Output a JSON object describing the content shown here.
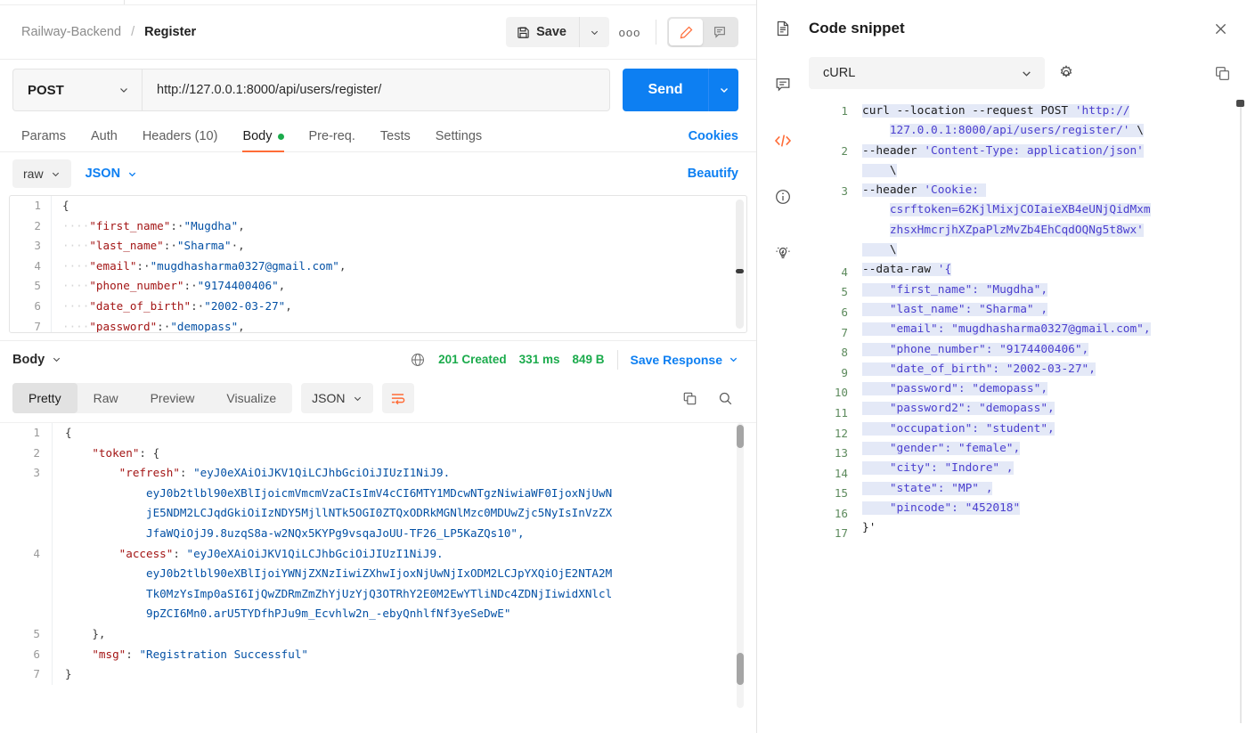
{
  "breadcrumb": {
    "collection": "Railway-Backend",
    "separator": "/",
    "current": "Register"
  },
  "toolbar": {
    "save_label": "Save",
    "save_icon": "floppy-disk-icon",
    "caret_icon": "chevron-down-icon",
    "more_icon": "ellipsis-icon",
    "more_label": "ooo",
    "edit_icon": "pencil-icon",
    "comment_icon": "comment-icon"
  },
  "request": {
    "method": "POST",
    "url": "http://127.0.0.1:8000/api/users/register/",
    "send_label": "Send",
    "tabs": [
      {
        "label": "Params",
        "active": false,
        "dot": false
      },
      {
        "label": "Auth",
        "active": false,
        "dot": false
      },
      {
        "label": "Headers (10)",
        "active": false,
        "dot": false
      },
      {
        "label": "Body",
        "active": true,
        "dot": true
      },
      {
        "label": "Pre-req.",
        "active": false,
        "dot": false
      },
      {
        "label": "Tests",
        "active": false,
        "dot": false
      },
      {
        "label": "Settings",
        "active": false,
        "dot": false
      }
    ],
    "cookies_label": "Cookies",
    "body_mode": "raw",
    "body_format": "JSON",
    "beautify_label": "Beautify",
    "body_lines": [
      {
        "n": "1",
        "segs": [
          {
            "t": "{",
            "c": "jpun"
          }
        ]
      },
      {
        "n": "2",
        "segs": [
          {
            "t": "····",
            "c": "jdot"
          },
          {
            "t": "\"first_name\"",
            "c": "jkey"
          },
          {
            "t": ":·",
            "c": "jpun"
          },
          {
            "t": "\"Mugdha\"",
            "c": "jstr"
          },
          {
            "t": ",",
            "c": "jpun"
          }
        ]
      },
      {
        "n": "3",
        "segs": [
          {
            "t": "····",
            "c": "jdot"
          },
          {
            "t": "\"last_name\"",
            "c": "jkey"
          },
          {
            "t": ":·",
            "c": "jpun"
          },
          {
            "t": "\"Sharma\"",
            "c": "jstr"
          },
          {
            "t": "·,",
            "c": "jpun"
          }
        ]
      },
      {
        "n": "4",
        "segs": [
          {
            "t": "····",
            "c": "jdot"
          },
          {
            "t": "\"email\"",
            "c": "jkey"
          },
          {
            "t": ":·",
            "c": "jpun"
          },
          {
            "t": "\"mugdhasharma0327@gmail.com\"",
            "c": "jstr"
          },
          {
            "t": ",",
            "c": "jpun"
          }
        ]
      },
      {
        "n": "5",
        "segs": [
          {
            "t": "····",
            "c": "jdot"
          },
          {
            "t": "\"phone_number\"",
            "c": "jkey"
          },
          {
            "t": ":·",
            "c": "jpun"
          },
          {
            "t": "\"9174400406\"",
            "c": "jstr"
          },
          {
            "t": ",",
            "c": "jpun"
          }
        ]
      },
      {
        "n": "6",
        "segs": [
          {
            "t": "····",
            "c": "jdot"
          },
          {
            "t": "\"date_of_birth\"",
            "c": "jkey"
          },
          {
            "t": ":·",
            "c": "jpun"
          },
          {
            "t": "\"2002-03-27\"",
            "c": "jstr"
          },
          {
            "t": ",",
            "c": "jpun"
          }
        ]
      },
      {
        "n": "7",
        "segs": [
          {
            "t": "····",
            "c": "jdot"
          },
          {
            "t": "\"password\"",
            "c": "jkey"
          },
          {
            "t": ":·",
            "c": "jpun"
          },
          {
            "t": "\"demopass\"",
            "c": "jstr"
          },
          {
            "t": ",",
            "c": "jpun"
          }
        ]
      }
    ]
  },
  "response": {
    "section_label": "Body",
    "globe_icon": "globe-icon",
    "status": "201 Created",
    "time": "331 ms",
    "size": "849 B",
    "save_response_label": "Save Response",
    "views": [
      {
        "label": "Pretty",
        "active": true
      },
      {
        "label": "Raw",
        "active": false
      },
      {
        "label": "Preview",
        "active": false
      },
      {
        "label": "Visualize",
        "active": false
      }
    ],
    "format": "JSON",
    "wrap_icon": "word-wrap-icon",
    "copy_icon": "copy-icon",
    "search_icon": "search-icon",
    "body_lines": [
      {
        "n": "1",
        "segs": [
          {
            "t": "{",
            "c": "jpun"
          }
        ]
      },
      {
        "n": "2",
        "segs": [
          {
            "t": "    ",
            "c": "jpun"
          },
          {
            "t": "\"token\"",
            "c": "jkey"
          },
          {
            "t": ": {",
            "c": "jpun"
          }
        ]
      },
      {
        "n": "3",
        "segs": [
          {
            "t": "        ",
            "c": "jpun"
          },
          {
            "t": "\"refresh\"",
            "c": "jkey"
          },
          {
            "t": ": ",
            "c": "jpun"
          },
          {
            "t": "\"eyJ0eXAiOiJKV1QiLCJhbGciOiJIUzI1NiJ9.",
            "c": "jstr"
          }
        ]
      },
      {
        "n": "",
        "segs": [
          {
            "t": "            ",
            "c": "jpun"
          },
          {
            "t": "eyJ0b2tlbl90eXBlIjoicmVmcmVzaCIsImV4cCI6MTY1MDcwNTgzNiwiaWF0IjoxNjUwN",
            "c": "jstr"
          }
        ]
      },
      {
        "n": "",
        "segs": [
          {
            "t": "            ",
            "c": "jpun"
          },
          {
            "t": "jE5NDM2LCJqdGkiOiIzNDY5MjllNTk5OGI0ZTQxODRkMGNlMzc0MDUwZjc5NyIsInVzZX",
            "c": "jstr"
          }
        ]
      },
      {
        "n": "",
        "segs": [
          {
            "t": "            ",
            "c": "jpun"
          },
          {
            "t": "JfaWQiOjJ9.8uzqS8a-w2NQx5KYPg9vsqaJoUU-TF26_LP5KaZQs10\",",
            "c": "jstr"
          }
        ]
      },
      {
        "n": "4",
        "segs": [
          {
            "t": "        ",
            "c": "jpun"
          },
          {
            "t": "\"access\"",
            "c": "jkey"
          },
          {
            "t": ": ",
            "c": "jpun"
          },
          {
            "t": "\"eyJ0eXAiOiJKV1QiLCJhbGciOiJIUzI1NiJ9.",
            "c": "jstr"
          }
        ]
      },
      {
        "n": "",
        "segs": [
          {
            "t": "            ",
            "c": "jpun"
          },
          {
            "t": "eyJ0b2tlbl90eXBlIjoiYWNjZXNzIiwiZXhwIjoxNjUwNjIxODM2LCJpYXQiOjE2NTA2M",
            "c": "jstr"
          }
        ]
      },
      {
        "n": "",
        "segs": [
          {
            "t": "            ",
            "c": "jpun"
          },
          {
            "t": "Tk0MzYsImp0aSI6IjQwZDRmZmZhYjUzYjQ3OTRhY2E0M2EwYTliNDc4ZDNjIiwidXNlcl",
            "c": "jstr"
          }
        ]
      },
      {
        "n": "",
        "segs": [
          {
            "t": "            ",
            "c": "jpun"
          },
          {
            "t": "9pZCI6Mn0.arU5TYDfhPJu9m_Ecvhlw2n_-ebyQnhlfNf3yeSeDwE\"",
            "c": "jstr"
          }
        ]
      },
      {
        "n": "5",
        "segs": [
          {
            "t": "    },",
            "c": "jpun"
          }
        ]
      },
      {
        "n": "6",
        "segs": [
          {
            "t": "    ",
            "c": "jpun"
          },
          {
            "t": "\"msg\"",
            "c": "jkey"
          },
          {
            "t": ": ",
            "c": "jpun"
          },
          {
            "t": "\"Registration Successful\"",
            "c": "jstr"
          }
        ]
      },
      {
        "n": "7",
        "segs": [
          {
            "t": "}",
            "c": "jpun"
          }
        ]
      }
    ]
  },
  "side_panel": {
    "rail_icons": [
      {
        "name": "documentation-icon",
        "active": false
      },
      {
        "name": "comments-icon",
        "active": false
      },
      {
        "name": "code-icon",
        "active": true
      },
      {
        "name": "info-icon",
        "active": false
      },
      {
        "name": "lightbulb-icon",
        "active": false
      }
    ],
    "title": "Code snippet",
    "title_icon": "document-icon",
    "close_icon": "close-icon",
    "language": "cURL",
    "settings_icon": "gear-icon",
    "copy_icon": "copy-icon",
    "code_lines": [
      {
        "n": "1",
        "segs": [
          {
            "t": "curl --location --request POST ",
            "c": "ctok",
            "hl": true
          },
          {
            "t": "'http://",
            "c": "cstr",
            "hl": true
          }
        ]
      },
      {
        "n": "",
        "segs": [
          {
            "t": "    ",
            "c": "ctok",
            "hl": false
          },
          {
            "t": "127.0.0.1:8000/api/users/register/'",
            "c": "cstr",
            "hl": true
          },
          {
            "t": " \\",
            "c": "ctok",
            "hl": true
          }
        ]
      },
      {
        "n": "2",
        "segs": [
          {
            "t": "--header ",
            "c": "ctok",
            "hl": true
          },
          {
            "t": "'Content-Type: application/json'",
            "c": "cstr",
            "hl": true
          }
        ]
      },
      {
        "n": "",
        "segs": [
          {
            "t": "    \\",
            "c": "ctok",
            "hl": true
          }
        ]
      },
      {
        "n": "3",
        "segs": [
          {
            "t": "--header ",
            "c": "ctok",
            "hl": true
          },
          {
            "t": "'Cookie: ",
            "c": "cstr",
            "hl": true
          }
        ]
      },
      {
        "n": "",
        "segs": [
          {
            "t": "    ",
            "c": "ctok",
            "hl": false
          },
          {
            "t": "csrftoken=62KjlMixjCOIaieXB4eUNjQidMxm",
            "c": "cstr",
            "hl": true
          }
        ]
      },
      {
        "n": "",
        "segs": [
          {
            "t": "    ",
            "c": "ctok",
            "hl": false
          },
          {
            "t": "zhsxHmcrjhXZpaPlzMvZb4EhCqdOQNg5t8wx'",
            "c": "cstr",
            "hl": true
          }
        ]
      },
      {
        "n": "",
        "segs": [
          {
            "t": "    \\",
            "c": "ctok",
            "hl": true
          }
        ]
      },
      {
        "n": "4",
        "segs": [
          {
            "t": "--data-raw ",
            "c": "ctok",
            "hl": true
          },
          {
            "t": "'{",
            "c": "cstr",
            "hl": true
          }
        ]
      },
      {
        "n": "5",
        "segs": [
          {
            "t": "    ",
            "c": "cstr",
            "hl": true
          },
          {
            "t": "\"first_name\": \"Mugdha\",",
            "c": "cstr",
            "hl": true
          }
        ]
      },
      {
        "n": "6",
        "segs": [
          {
            "t": "    ",
            "c": "cstr",
            "hl": true
          },
          {
            "t": "\"last_name\": \"Sharma\" ,",
            "c": "cstr",
            "hl": true
          }
        ]
      },
      {
        "n": "7",
        "segs": [
          {
            "t": "    ",
            "c": "cstr",
            "hl": true
          },
          {
            "t": "\"email\": \"mugdhasharma0327@gmail.com\",",
            "c": "cstr",
            "hl": true
          }
        ]
      },
      {
        "n": "8",
        "segs": [
          {
            "t": "    ",
            "c": "cstr",
            "hl": true
          },
          {
            "t": "\"phone_number\": \"9174400406\",",
            "c": "cstr",
            "hl": true
          }
        ]
      },
      {
        "n": "9",
        "segs": [
          {
            "t": "    ",
            "c": "cstr",
            "hl": true
          },
          {
            "t": "\"date_of_birth\": \"2002-03-27\",",
            "c": "cstr",
            "hl": true
          }
        ]
      },
      {
        "n": "10",
        "segs": [
          {
            "t": "    ",
            "c": "cstr",
            "hl": true
          },
          {
            "t": "\"password\": \"demopass\",",
            "c": "cstr",
            "hl": true
          }
        ]
      },
      {
        "n": "11",
        "segs": [
          {
            "t": "    ",
            "c": "cstr",
            "hl": true
          },
          {
            "t": "\"password2\": \"demopass\",",
            "c": "cstr",
            "hl": true
          }
        ]
      },
      {
        "n": "12",
        "segs": [
          {
            "t": "    ",
            "c": "cstr",
            "hl": true
          },
          {
            "t": "\"occupation\": \"student\",",
            "c": "cstr",
            "hl": true
          }
        ]
      },
      {
        "n": "13",
        "segs": [
          {
            "t": "    ",
            "c": "cstr",
            "hl": true
          },
          {
            "t": "\"gender\": \"female\",",
            "c": "cstr",
            "hl": true
          }
        ]
      },
      {
        "n": "14",
        "segs": [
          {
            "t": "    ",
            "c": "cstr",
            "hl": true
          },
          {
            "t": "\"city\": \"Indore\" ,",
            "c": "cstr",
            "hl": true
          }
        ]
      },
      {
        "n": "15",
        "segs": [
          {
            "t": "    ",
            "c": "cstr",
            "hl": true
          },
          {
            "t": "\"state\": \"MP\" ,",
            "c": "cstr",
            "hl": true
          }
        ]
      },
      {
        "n": "16",
        "segs": [
          {
            "t": "    ",
            "c": "cstr",
            "hl": true
          },
          {
            "t": "\"pincode\": \"452018\"",
            "c": "cstr",
            "hl": true
          }
        ]
      },
      {
        "n": "17",
        "segs": [
          {
            "t": "}'",
            "c": "cpun",
            "hl": false
          }
        ]
      }
    ]
  },
  "colors": {
    "accent_orange": "#ff6c37",
    "primary_blue": "#0d7ff2",
    "status_green": "#1bab4c",
    "code_string": "#0451a5",
    "code_key": "#a31515"
  }
}
